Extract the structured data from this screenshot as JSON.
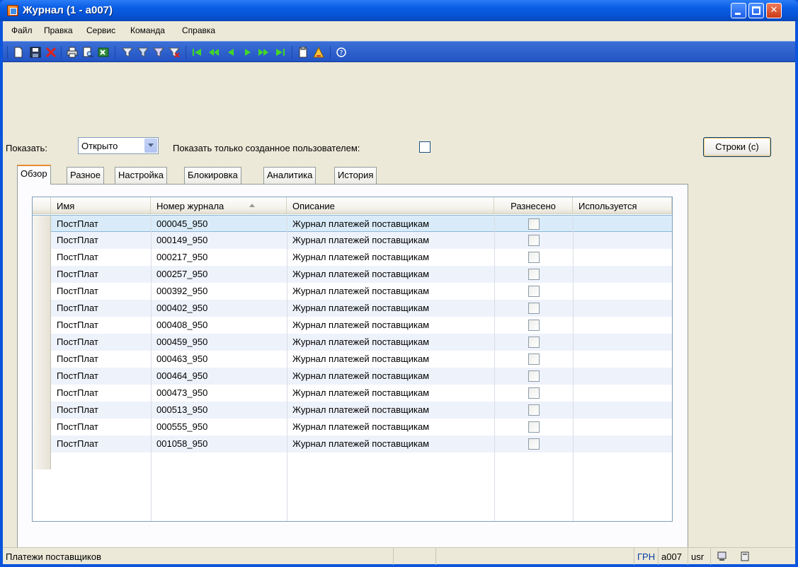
{
  "window": {
    "title": "Журнал (1 - a007)"
  },
  "menu": [
    "Файл",
    "Правка",
    "Сервис",
    "Команда",
    "Справка"
  ],
  "toolbar": {
    "icons": [
      "new-icon",
      "save-icon",
      "delete-icon",
      "print-icon",
      "print-preview-icon",
      "export-excel-icon",
      "filter-icon",
      "filter-by-selection-icon",
      "advanced-filter-icon",
      "remove-filter-icon",
      "first-record-icon",
      "previous-page-icon",
      "previous-record-icon",
      "next-record-icon",
      "next-page-icon",
      "last-record-icon",
      "document-handling-icon",
      "alert-icon",
      "help-icon"
    ]
  },
  "filter": {
    "show_label": "Показать:",
    "show_value": "Открыто",
    "only_user_label": "Показать только созданное пользователем:",
    "only_user_checked": false
  },
  "lines_button": "Строки (c)",
  "tabs": [
    "Обзор",
    "Разное",
    "Настройка",
    "Блокировка",
    "Аналитика",
    "История"
  ],
  "active_tab": 0,
  "grid": {
    "columns": [
      "Имя",
      "Номер журнала",
      "Описание",
      "Разнесено",
      "Используется"
    ],
    "rows": [
      {
        "name": "ПостПлат",
        "number": "000045_950",
        "description": "Журнал платежей поставщикам",
        "posted": false
      },
      {
        "name": "ПостПлат",
        "number": "000149_950",
        "description": "Журнал платежей поставщикам",
        "posted": false
      },
      {
        "name": "ПостПлат",
        "number": "000217_950",
        "description": "Журнал платежей поставщикам",
        "posted": false
      },
      {
        "name": "ПостПлат",
        "number": "000257_950",
        "description": "Журнал платежей поставщикам",
        "posted": false
      },
      {
        "name": "ПостПлат",
        "number": "000392_950",
        "description": "Журнал платежей поставщикам",
        "posted": false
      },
      {
        "name": "ПостПлат",
        "number": "000402_950",
        "description": "Журнал платежей поставщикам",
        "posted": false
      },
      {
        "name": "ПостПлат",
        "number": "000408_950",
        "description": "Журнал платежей поставщикам",
        "posted": false
      },
      {
        "name": "ПостПлат",
        "number": "000459_950",
        "description": "Журнал платежей поставщикам",
        "posted": false
      },
      {
        "name": "ПостПлат",
        "number": "000463_950",
        "description": "Журнал платежей поставщикам",
        "posted": false
      },
      {
        "name": "ПостПлат",
        "number": "000464_950",
        "description": "Журнал платежей поставщикам",
        "posted": false
      },
      {
        "name": "ПостПлат",
        "number": "000473_950",
        "description": "Журнал платежей поставщикам",
        "posted": false
      },
      {
        "name": "ПостПлат",
        "number": "000513_950",
        "description": "Журнал платежей поставщикам",
        "posted": false
      },
      {
        "name": "ПостПлат",
        "number": "000555_950",
        "description": "Журнал платежей поставщикам",
        "posted": false
      },
      {
        "name": "ПостПлат",
        "number": "001058_950",
        "description": "Журнал платежей поставщикам",
        "posted": false
      }
    ]
  },
  "status": {
    "text": "Платежи поставщиков",
    "currency": "ГРН",
    "company": "a007",
    "user": "usr"
  },
  "colors": {
    "title_bar": "#0a5fe6",
    "toolbar": "#2b5fd0",
    "selected_row": "#d9ebf8",
    "currency_text": "#0b3fa8"
  }
}
